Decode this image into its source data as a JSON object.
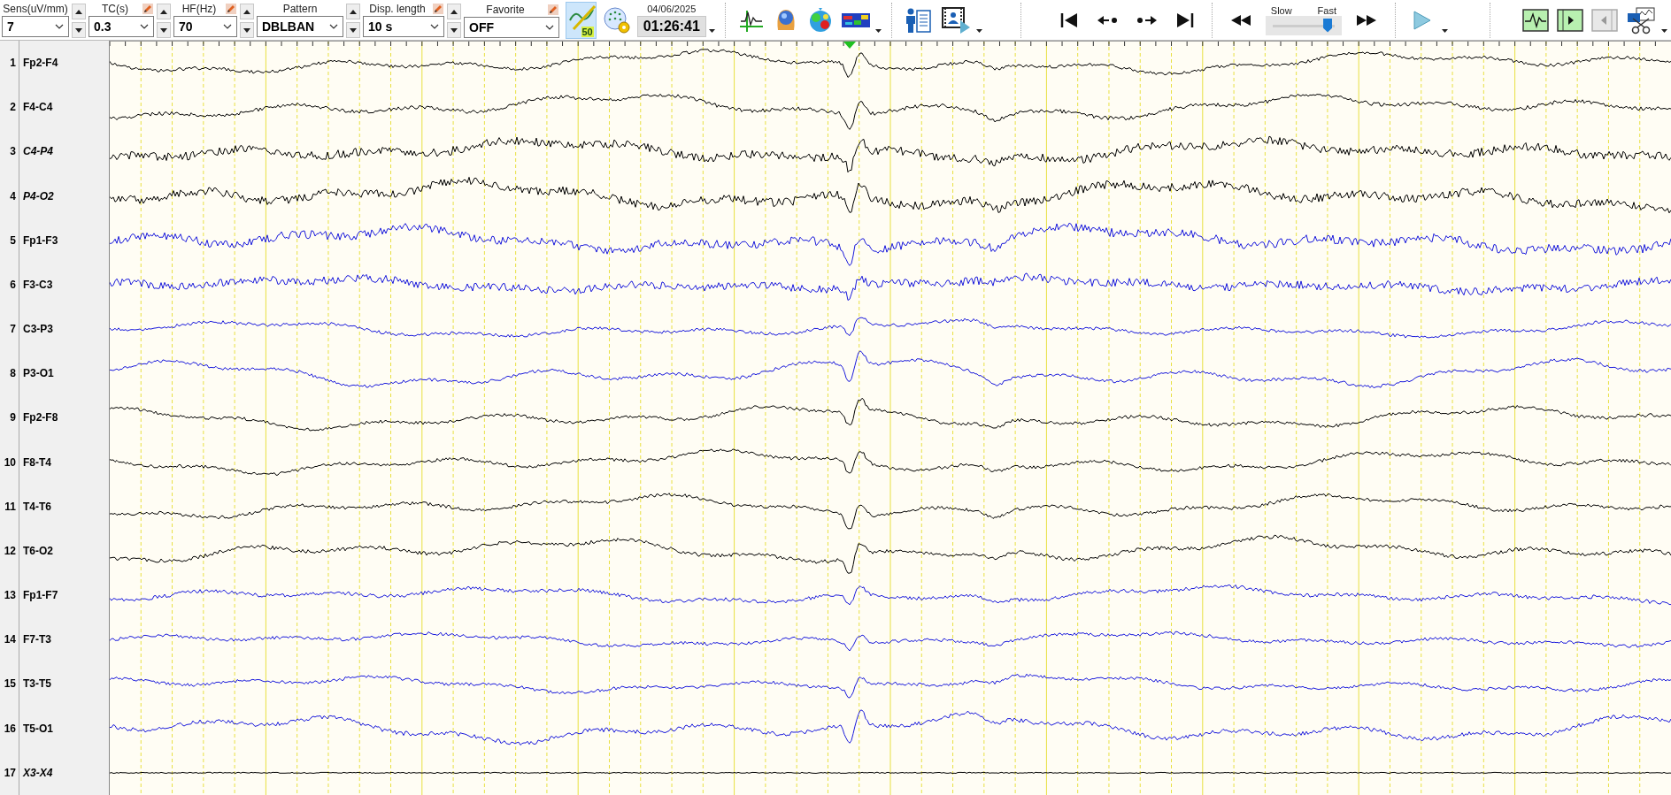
{
  "toolbar": {
    "settings": [
      {
        "label": "Sens(uV/mm)",
        "value": "7",
        "editable": false,
        "spinner": true
      },
      {
        "label": "TC(s)",
        "value": "0.3",
        "editable": true,
        "spinner": true
      },
      {
        "label": "HF(Hz)",
        "value": "70",
        "editable": true,
        "spinner": true
      },
      {
        "label": "Pattern",
        "value": "DBLBAN",
        "editable": false,
        "spinner": true
      },
      {
        "label": "Disp. length",
        "value": "10 s",
        "editable": true,
        "spinner": true
      },
      {
        "label": "Favorite",
        "value": "OFF",
        "editable": true,
        "spinner": false
      }
    ],
    "montage_badge": "50",
    "date": "04/06/2025",
    "time": "01:26:41",
    "speed": {
      "slow_label": "Slow",
      "fast_label": "Fast",
      "level": 0.85
    }
  },
  "channels": [
    {
      "number": "1",
      "label": "Fp2-F4",
      "italic": false,
      "color": "#000000"
    },
    {
      "number": "2",
      "label": "F4-C4",
      "italic": false,
      "color": "#000000"
    },
    {
      "number": "3",
      "label": "C4-P4",
      "italic": true,
      "color": "#000000"
    },
    {
      "number": "4",
      "label": "P4-O2",
      "italic": true,
      "color": "#000000"
    },
    {
      "number": "5",
      "label": "Fp1-F3",
      "italic": false,
      "color": "#1a1adc"
    },
    {
      "number": "6",
      "label": "F3-C3",
      "italic": false,
      "color": "#1a1adc"
    },
    {
      "number": "7",
      "label": "C3-P3",
      "italic": false,
      "color": "#1a1adc"
    },
    {
      "number": "8",
      "label": "P3-O1",
      "italic": false,
      "color": "#1a1adc"
    },
    {
      "number": "9",
      "label": "Fp2-F8",
      "italic": false,
      "color": "#000000"
    },
    {
      "number": "10",
      "label": "F8-T4",
      "italic": false,
      "color": "#000000"
    },
    {
      "number": "11",
      "label": "T4-T6",
      "italic": false,
      "color": "#000000"
    },
    {
      "number": "12",
      "label": "T6-O2",
      "italic": false,
      "color": "#000000"
    },
    {
      "number": "13",
      "label": "Fp1-F7",
      "italic": false,
      "color": "#1a1adc"
    },
    {
      "number": "14",
      "label": "F7-T3",
      "italic": false,
      "color": "#1a1adc"
    },
    {
      "number": "15",
      "label": "T3-T5",
      "italic": false,
      "color": "#1a1adc"
    },
    {
      "number": "16",
      "label": "T5-O1",
      "italic": false,
      "color": "#1a1adc"
    },
    {
      "number": "17",
      "label": "X3-X4",
      "italic": true,
      "color": "#000000"
    }
  ]
}
